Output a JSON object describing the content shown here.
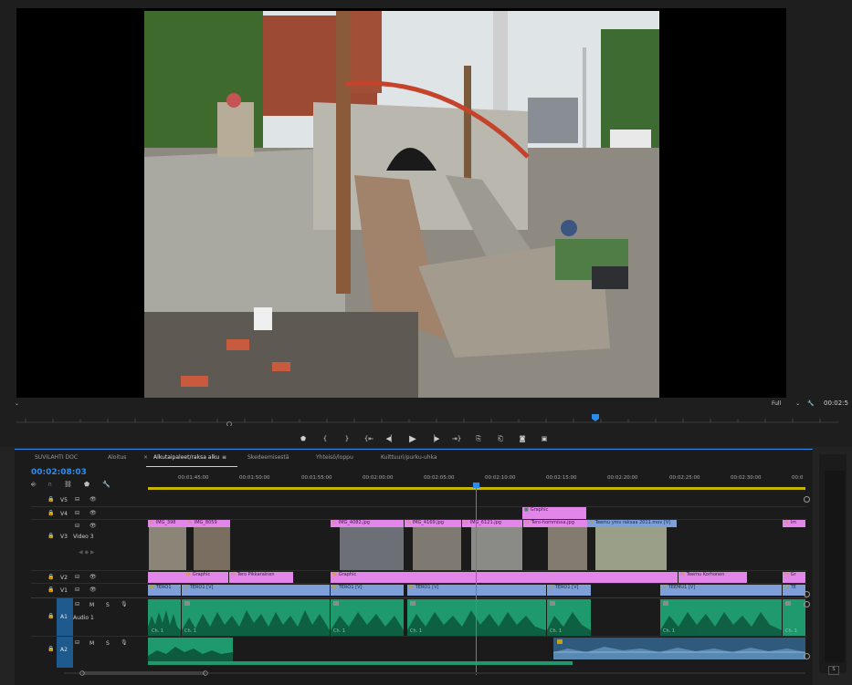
{
  "monitor": {
    "zoom": "Full",
    "timecode": "00:02:5"
  },
  "transport": {
    "buttons": [
      "marker",
      "in",
      "out",
      "go-to-in",
      "step-back",
      "play",
      "step-forward",
      "go-to-out",
      "lift",
      "extract",
      "export-frame",
      "compare"
    ]
  },
  "timeline": {
    "tabs": [
      "SUVILAHTI DOC",
      "Aloitus",
      "Alkutaipaleet/raksa alku",
      "Skedeemisestä",
      "Yhteisö/loppu",
      "Kulttuuri/purku-uhka"
    ],
    "active_tab_index": 2,
    "close_glyph": "×",
    "menu_glyph": "≡",
    "timecode": "00:02:08:03",
    "ruler": [
      "00:01:45:00",
      "00:01:50:00",
      "00:01:55:00",
      "00:02:00:00",
      "00:02:05:00",
      "00:02:10:00",
      "00:02:15:00",
      "00:02:20:00",
      "00:02:25:00",
      "00:02:30:00",
      "00:0"
    ],
    "tracks": {
      "v5": "V5",
      "v4": "V4",
      "v3": "V3",
      "v3_name": "Video 3",
      "v2": "V2",
      "v1": "V1",
      "a1": "A1",
      "a1_name": "Audio 1",
      "a2": "A2",
      "m": "M",
      "s": "S"
    },
    "clips": {
      "v4_graphic": "Graphic",
      "v3_img_398": "IMG_398",
      "v3_img_8059": "IMG_8059",
      "v3_img_4082": "IMG_4082.jpg",
      "v3_img_4169": "IMG_4169.jpg",
      "v3_img_6121": "IMG_6121.jpg",
      "v3_tero": "Tero-hommissa.jpg",
      "v3_teemu": "Teemu yms raksaa 2011.mov [V]",
      "v3_last": "Im",
      "v2_graphic1": "Graphic",
      "v2_tero": "Tero Pikkarainen",
      "v2_graphic2": "Graphic",
      "v2_teemu": "Teemu Korhonen",
      "v2_last": "Gr",
      "v1_a": "TERO1",
      "v1_b": "TERO1 [V]",
      "v1_c": "TERO1 [V]",
      "v1_d": "TERO1 [V]",
      "v1_e": "TERO1 [V]",
      "v1_f": "TEEMU1 [V]",
      "v1_g": "TE",
      "a1_ch": "Ch. 1"
    }
  }
}
